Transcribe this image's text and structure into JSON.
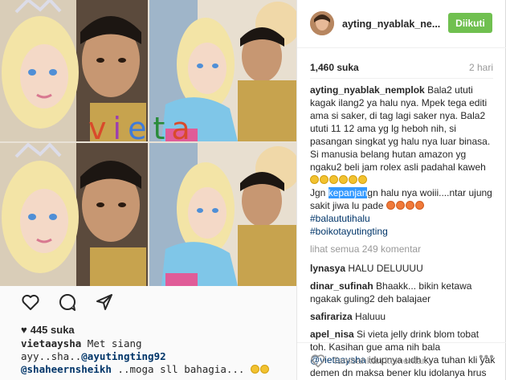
{
  "post": {
    "watermark": [
      "v",
      "i",
      "e",
      "t",
      "a"
    ],
    "actions": {
      "like_icon": "heart-icon",
      "comment_icon": "comment-icon",
      "share_icon": "share-icon"
    },
    "likes_text": "445 suka",
    "caption": {
      "user": "vietaaysha",
      "text1": "Met siang",
      "text2": "ayy..sha..",
      "mention1": "@ayutingting92",
      "mention2": "@shaheernsheikh",
      "text3": "..moga sll bahagia..."
    }
  },
  "panel": {
    "username": "ayting_nyablak_ne...",
    "follow_label": "Diikuti",
    "likes_count": "1,460 suka",
    "time_ago": "2 hari",
    "main_comment": {
      "user": "ayting_nyablak_nemplok",
      "text_a": "Bala2 ututi kagak ilang2 ya halu nya. Mpek tega editi ama si saker, di tag lagi saker nya. Bala2 ututi 11 12 ama yg lg heboh nih, si pasangan singkat yg halu nya luar binasa. Si manusia belang hutan amazon yg ngaku2 beli jam rolex asli padahal kaweh",
      "text_b": "Jgn ",
      "highlight": "kepanjan",
      "text_c": "gn halu nya woiii....ntar ujung sakit jiwa lu pade",
      "hashtag1": "#balaututihalu",
      "hashtag2": "#boikotayutingting"
    },
    "view_all": "lihat semua 249 komentar",
    "comments": [
      {
        "user": "lynasya",
        "text": "HALU DELUUUU"
      },
      {
        "user": "dinar_sufinah",
        "text": "Bhaakk... bikin ketawa ngakak guling2 deh balajaer"
      },
      {
        "user": "safirariza",
        "text": "Haluuu"
      }
    ],
    "last_comment": {
      "user": "apel_nisa",
      "text_a": "Si vieta jelly drink blom tobat toh. Kasihan gue ama nih bala ",
      "mention": "@vietaaysha",
      "text_b": " idupnya udh kya tuhan kli yak demen dn maksa bener klu idolanya hrus jodoh ama"
    },
    "comment_placeholder": "Tambahkan komentar...",
    "more_icon": "more-dots-icon"
  }
}
